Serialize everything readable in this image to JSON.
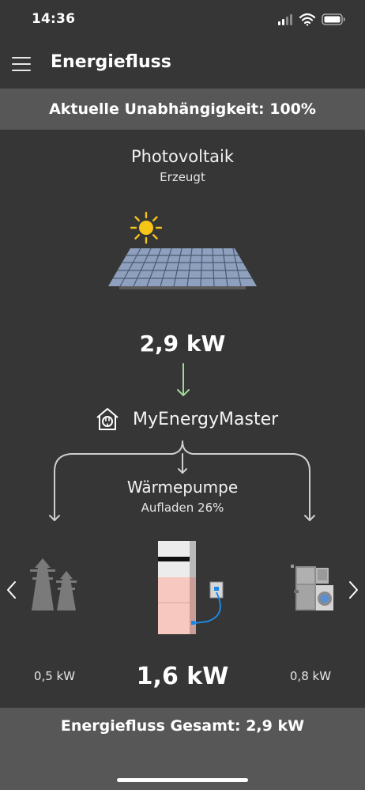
{
  "status_bar": {
    "time": "14:36",
    "icons": [
      "cellular-signal-icon",
      "wifi-icon",
      "battery-icon"
    ]
  },
  "header": {
    "title": "Energiefluss",
    "menu_icon": "hamburger-menu-icon"
  },
  "independence_banner": "Aktuelle Unabhängigkeit: 100%",
  "photovoltaic": {
    "title": "Photovoltaik",
    "subtitle": "Erzeugt",
    "value": "2,9 kW",
    "icons": [
      "sun-icon",
      "solar-panel-icon"
    ]
  },
  "hub": {
    "label": "MyEnergyMaster",
    "icon": "house-plug-icon"
  },
  "heat_pump": {
    "title": "Wärmepumpe",
    "subtitle": "Aufladen 26%",
    "charge_percent": 26,
    "value": "1,6 kW",
    "icon": "heat-pump-storage-icon"
  },
  "grid": {
    "value": "0,5 kW",
    "icon": "power-pylon-icon"
  },
  "household": {
    "value": "0,8 kW",
    "icon": "household-appliances-icon"
  },
  "navigation": {
    "prev_icon": "chevron-left-icon",
    "next_icon": "chevron-right-icon"
  },
  "total_banner": "Energiefluss Gesamt: 2,9 kW",
  "colors": {
    "background": "#363636",
    "banner": "#575757",
    "flow_arrow_active": "#9fd89a",
    "flow_lines": "#cfcfcf",
    "sun": "#f5c518",
    "storage_fill": "#f6c8c0"
  }
}
